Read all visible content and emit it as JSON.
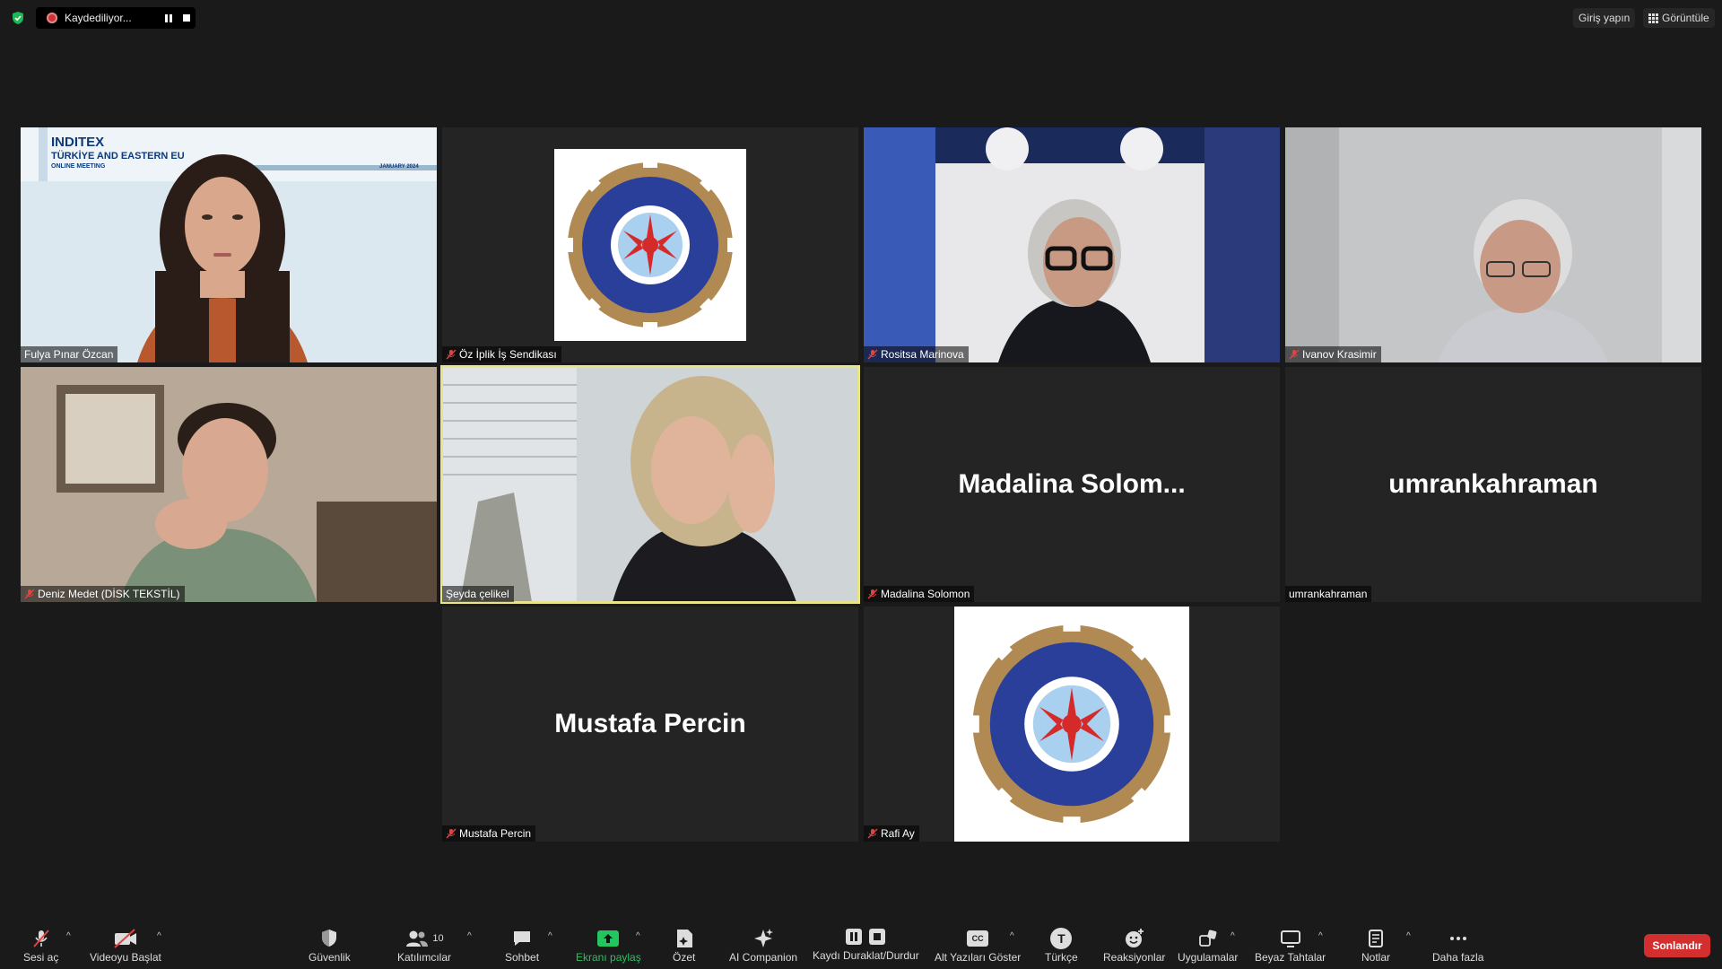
{
  "topbar": {
    "recording_label": "Kaydediliyor...",
    "signin_label": "Giriş yapın",
    "view_label": "Görüntüle"
  },
  "tiles": [
    {
      "name": "Fulya Pınar Özcan",
      "muted": false,
      "type": "video"
    },
    {
      "name": "Öz İplik İş Sendikası",
      "muted": true,
      "type": "logo"
    },
    {
      "name": "Rositsa Marinova",
      "muted": true,
      "type": "video"
    },
    {
      "name": "Ivanov Krasimir",
      "muted": true,
      "type": "video"
    },
    {
      "name": "Deniz Medet (DİSK TEKSTİL)",
      "muted": true,
      "type": "video"
    },
    {
      "name": "Şeyda çelikel",
      "muted": false,
      "type": "video",
      "active": true
    },
    {
      "name": "Madalina Solomon",
      "muted": true,
      "type": "name",
      "display_name": "Madalina  Solom..."
    },
    {
      "name": "umrankahraman",
      "muted": false,
      "type": "name",
      "display_name": "umrankahraman"
    },
    {
      "name": "Mustafa Percin",
      "muted": true,
      "type": "name",
      "display_name": "Mustafa Percin"
    },
    {
      "name": "Rafi Ay",
      "muted": true,
      "type": "logo"
    }
  ],
  "video_overlays": {
    "inditex_title": "INDITEX",
    "inditex_sub": "TÜRKİYE AND EASTERN EU",
    "inditex_meeting": "ONLINE MEETING",
    "inditex_date": "JANUARY 2024"
  },
  "toolbar": {
    "unmute": "Sesi aç",
    "start_video": "Videoyu Başlat",
    "security": "Güvenlik",
    "participants": "Katılımcılar",
    "participants_count": "10",
    "chat": "Sohbet",
    "share": "Ekranı paylaş",
    "summary": "Özet",
    "ai": "AI Companion",
    "record": "Kaydı Duraklat/Durdur",
    "captions": "Alt Yazıları Göster",
    "cc": "CC",
    "language": "Türkçe",
    "language_letter": "T",
    "reactions": "Reaksiyonlar",
    "apps": "Uygulamalar",
    "whiteboards": "Beyaz Tahtalar",
    "notes": "Notlar",
    "more": "Daha fazla",
    "end": "Sonlandır"
  },
  "colors": {
    "share_green": "#22c55e",
    "end_red": "#d32f2f",
    "active_border": "#e9e48a",
    "muted_red": "#e04343"
  }
}
